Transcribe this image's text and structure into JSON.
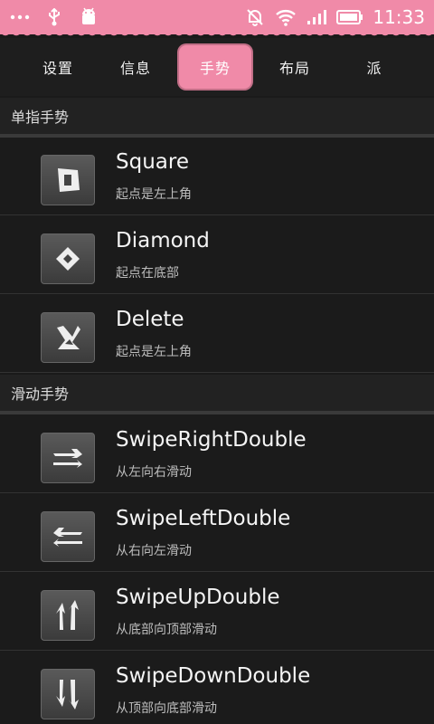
{
  "status_bar": {
    "time": "11:33",
    "left_icons": [
      "overflow-dots-icon",
      "usb-icon",
      "android-debug-icon"
    ],
    "right_icons": [
      "notifications-off-icon",
      "wifi-icon",
      "signal-icon",
      "battery-icon"
    ],
    "accent": "#f08aa8"
  },
  "tabs": [
    {
      "label": "设置",
      "active": false
    },
    {
      "label": "信息",
      "active": false
    },
    {
      "label": "手势",
      "active": true
    },
    {
      "label": "布局",
      "active": false
    },
    {
      "label": "派",
      "active": false
    }
  ],
  "sections": [
    {
      "header": "单指手势",
      "items": [
        {
          "title": "Square",
          "subtitle": "起点是左上角",
          "icon": "square-gesture-icon"
        },
        {
          "title": "Diamond",
          "subtitle": "起点在底部",
          "icon": "diamond-gesture-icon"
        },
        {
          "title": "Delete",
          "subtitle": "起点是左上角",
          "icon": "delete-gesture-icon"
        }
      ]
    },
    {
      "header": "滑动手势",
      "items": [
        {
          "title": "SwipeRightDouble",
          "subtitle": "从左向右滑动",
          "icon": "swipe-right-double-icon"
        },
        {
          "title": "SwipeLeftDouble",
          "subtitle": "从右向左滑动",
          "icon": "swipe-left-double-icon"
        },
        {
          "title": "SwipeUpDouble",
          "subtitle": "从底部向顶部滑动",
          "icon": "swipe-up-double-icon"
        },
        {
          "title": "SwipeDownDouble",
          "subtitle": "从顶部向底部滑动",
          "icon": "swipe-down-double-icon"
        }
      ]
    }
  ]
}
